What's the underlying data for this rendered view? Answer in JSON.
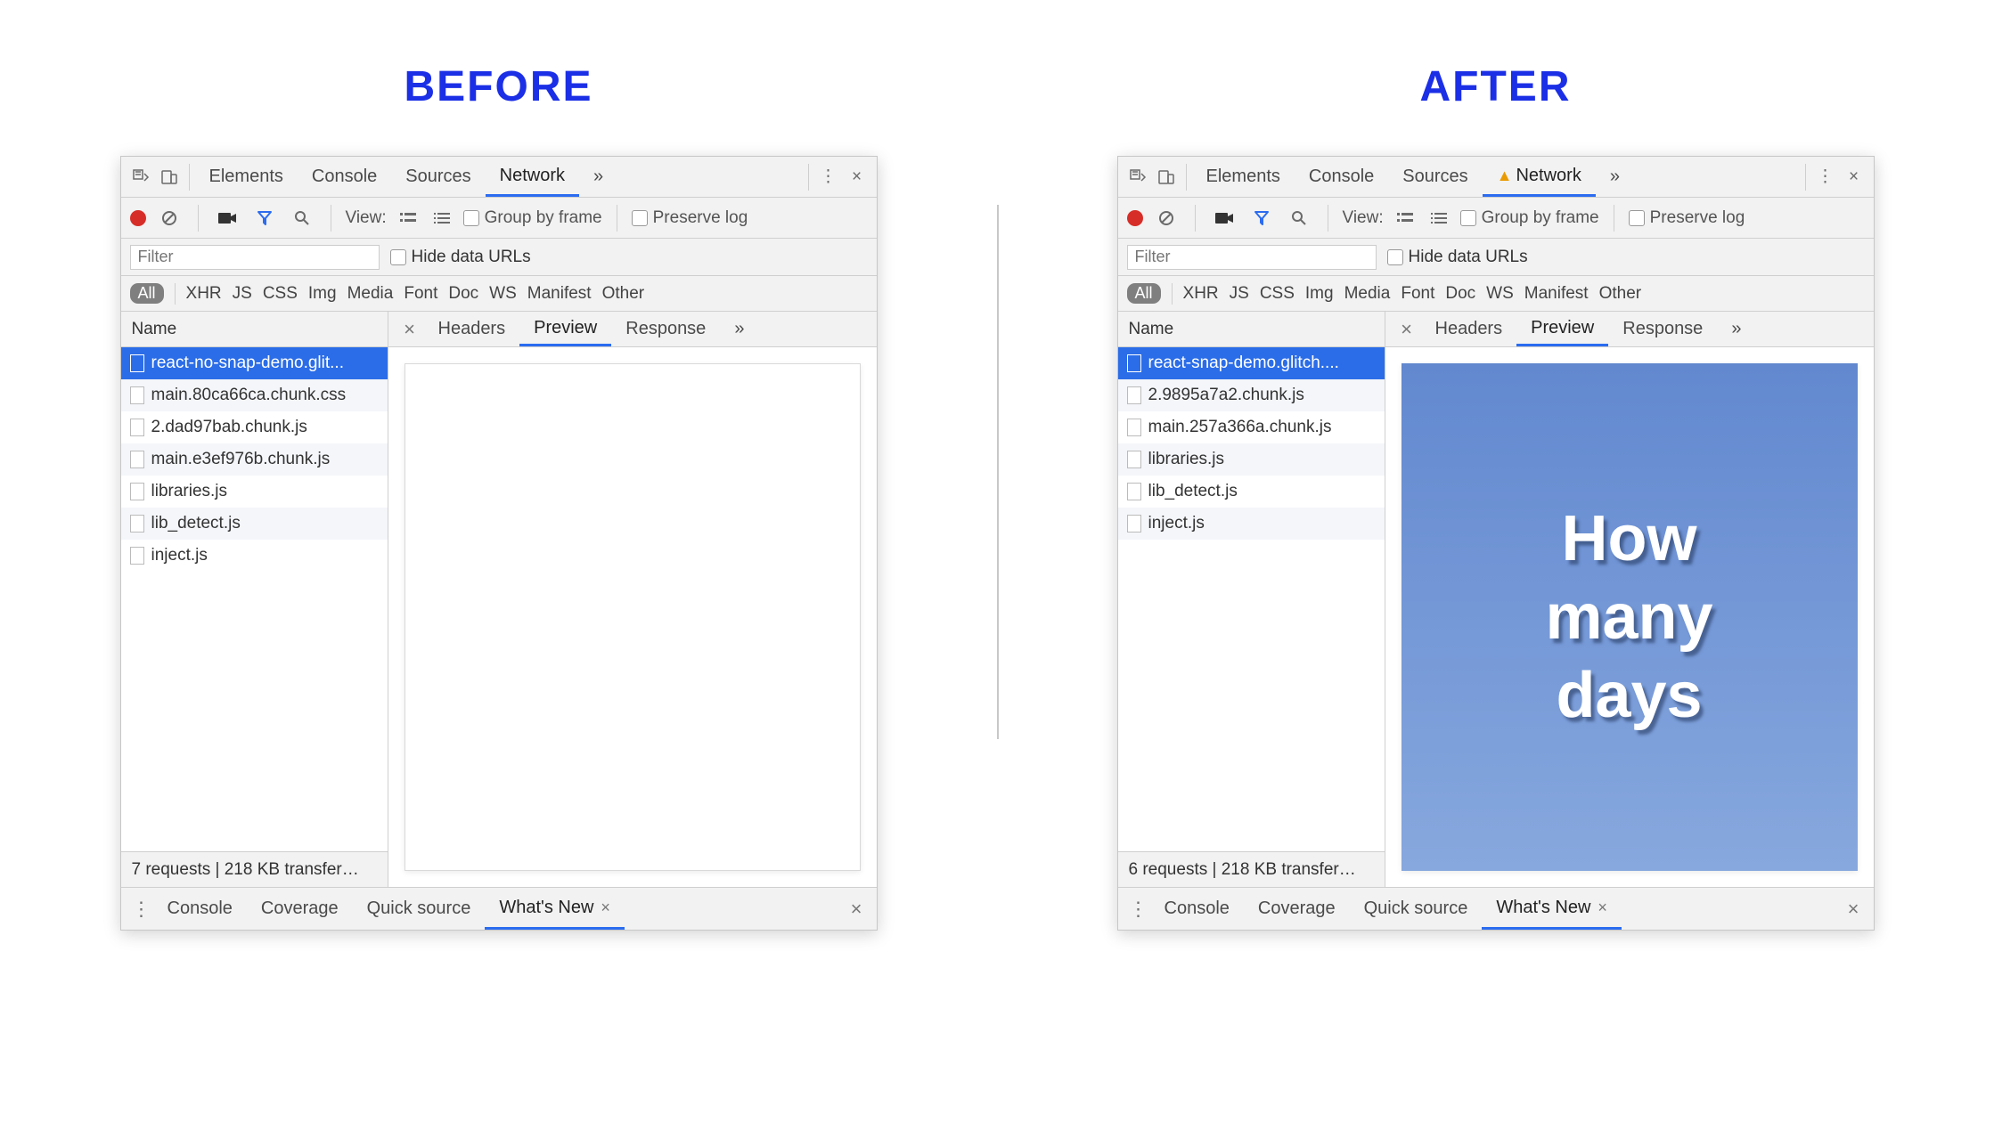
{
  "labels": {
    "before": "BEFORE",
    "after": "AFTER"
  },
  "topbar": {
    "tabs": [
      "Elements",
      "Console",
      "Sources",
      "Network"
    ],
    "more": "»",
    "kebab": "⋮",
    "close": "×"
  },
  "secondbar": {
    "view_label": "View:",
    "group_by_frame": "Group by frame",
    "preserve_log": "Preserve log"
  },
  "filterrow": {
    "placeholder": "Filter",
    "hide_data_urls": "Hide data URLs"
  },
  "typerow": {
    "all": "All",
    "types": [
      "XHR",
      "JS",
      "CSS",
      "Img",
      "Media",
      "Font",
      "Doc",
      "WS",
      "Manifest",
      "Other"
    ]
  },
  "leftcol": {
    "name_header": "Name"
  },
  "righthead": {
    "tabs": [
      "Headers",
      "Preview",
      "Response"
    ],
    "more": "»",
    "close": "×"
  },
  "drawer": {
    "tabs": [
      "Console",
      "Coverage",
      "Quick source",
      "What's New"
    ],
    "close": "×"
  },
  "panels": {
    "before": {
      "warn": false,
      "requests": [
        "react-no-snap-demo.glit...",
        "main.80ca66ca.chunk.css",
        "2.dad97bab.chunk.js",
        "main.e3ef976b.chunk.js",
        "libraries.js",
        "lib_detect.js",
        "inject.js"
      ],
      "status": "7 requests | 218 KB transfer…",
      "preview": {
        "type": "blank"
      }
    },
    "after": {
      "warn": true,
      "requests": [
        "react-snap-demo.glitch....",
        "2.9895a7a2.chunk.js",
        "main.257a366a.chunk.js",
        "libraries.js",
        "lib_detect.js",
        "inject.js"
      ],
      "status": "6 requests | 218 KB transfer…",
      "preview": {
        "type": "blue",
        "lines": [
          "How",
          "many",
          "days"
        ]
      }
    }
  }
}
